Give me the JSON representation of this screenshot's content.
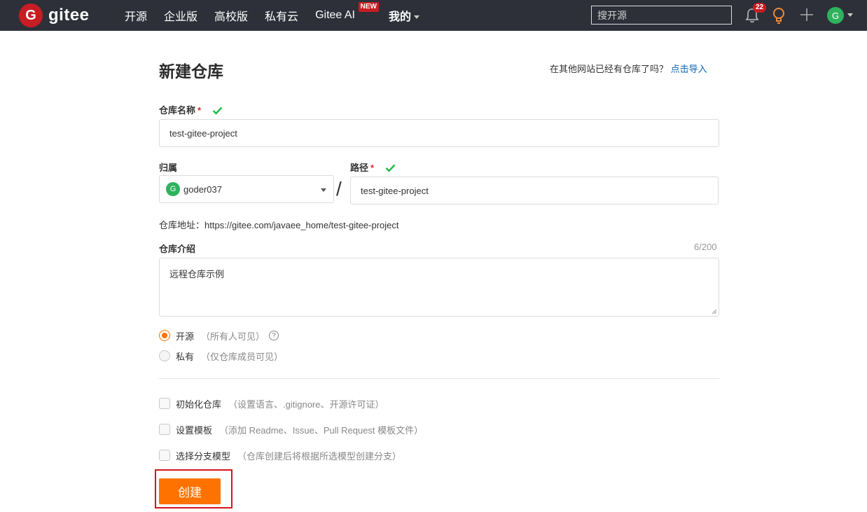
{
  "nav": {
    "logo_mark": "G",
    "logo_text": "gitee",
    "links": [
      "开源",
      "企业版",
      "高校版",
      "私有云",
      "Gitee AI"
    ],
    "new_badge": "NEW",
    "mine": "我的",
    "search_placeholder": "搜开源",
    "notification_count": "22",
    "avatar_letter": "G"
  },
  "page": {
    "title": "新建仓库",
    "import_prompt": "在其他网站已经有仓库了吗？",
    "import_link": "点击导入"
  },
  "form": {
    "repo_name_label": "仓库名称",
    "required_mark": "*",
    "repo_name_value": "test-gitee-project",
    "owner_label": "归属",
    "owner_avatar": "G",
    "owner_value": "goder037",
    "slash": "/",
    "path_label": "路径",
    "path_value": "test-gitee-project",
    "address_label": "仓库地址：",
    "address_value": "https://gitee.com/javaee_home/test-gitee-project",
    "intro_label": "仓库介绍",
    "intro_counter": "6/200",
    "intro_value": "远程仓库示例",
    "visibility": {
      "public_label": "开源",
      "public_hint": "（所有人可见）",
      "help": "?",
      "private_label": "私有",
      "private_hint": "（仅仓库成员可见）",
      "selected": "public"
    },
    "options": [
      {
        "label": "初始化仓库",
        "hint": "（设置语言、.gitignore、开源许可证）"
      },
      {
        "label": "设置模板",
        "hint": "（添加 Readme、Issue、Pull Request 模板文件）"
      },
      {
        "label": "选择分支模型",
        "hint": "（仓库创建后将根据所选模型创建分支）"
      }
    ],
    "create_button": "创建"
  },
  "colors": {
    "nav_bg": "#2d3039",
    "brand_red": "#c71d23",
    "accent_orange": "#fe7300",
    "link_blue": "#0a66b7",
    "check_green": "#21ba45",
    "highlight_red": "#d6141b"
  }
}
